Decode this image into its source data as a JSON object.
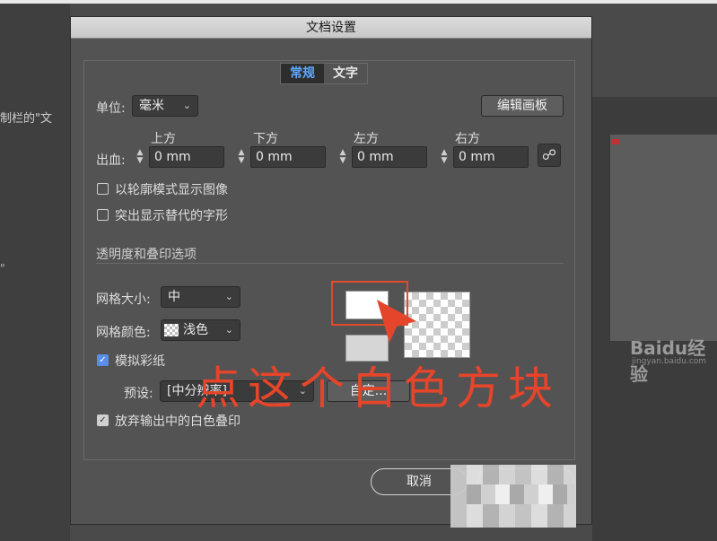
{
  "background": {
    "left_text": "制栏的\"文",
    "left_mark": "\"",
    "watermark": "Baidu经验",
    "watermark_sub": "jingyan.baidu.com"
  },
  "dialog": {
    "title": "文档设置",
    "tabs": [
      {
        "label": "常规",
        "active": true
      },
      {
        "label": "文字",
        "active": false
      }
    ],
    "units": {
      "label": "单位:",
      "value": "毫米"
    },
    "edit_artboard_label": "编辑画板",
    "bleed": {
      "label": "出血:",
      "fields": [
        {
          "label": "上方",
          "value": "0 mm"
        },
        {
          "label": "下方",
          "value": "0 mm"
        },
        {
          "label": "左方",
          "value": "0 mm"
        },
        {
          "label": "右方",
          "value": "0 mm"
        }
      ]
    },
    "options": [
      {
        "label": "以轮廓模式显示图像",
        "checked": false
      },
      {
        "label": "突出显示替代的字形",
        "checked": false
      }
    ],
    "transparency_section": "透明度和叠印选项",
    "grid_size": {
      "label": "网格大小:",
      "value": "中"
    },
    "grid_color": {
      "label": "网格颜色:",
      "value": "浅色"
    },
    "simulate_paper": {
      "label": "模拟彩纸",
      "checked": true
    },
    "preset": {
      "label": "预设:",
      "value": "[中分辨率]",
      "custom_label": "自定..."
    },
    "discard_white": {
      "label": "放弃输出中的白色叠印",
      "checked": true
    },
    "cancel_label": "取消"
  },
  "annotation": "点这个白色方块",
  "colors": {
    "accent_tab": "#5fa9ff",
    "annotation_red": "#e5452a",
    "checkbox_blue": "#5a8ee8"
  }
}
